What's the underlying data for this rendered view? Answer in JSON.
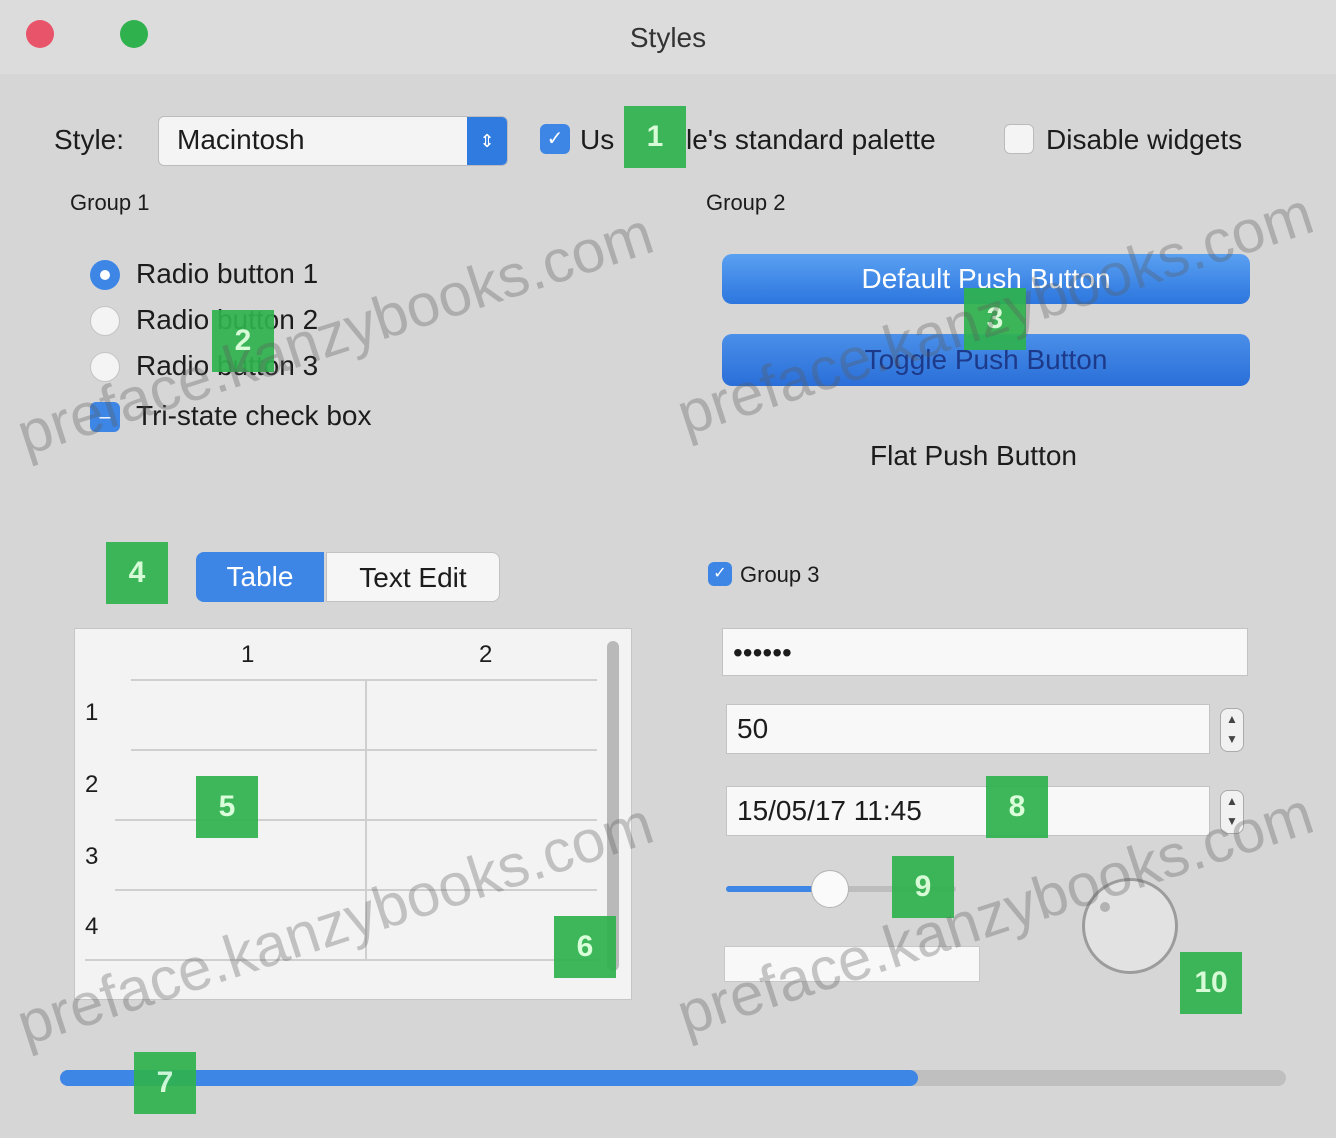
{
  "window": {
    "title": "Styles"
  },
  "toolbar": {
    "style_label": "Style:",
    "style_value": "Macintosh",
    "palette_label_start": "Us",
    "palette_label_end": "le's standard palette",
    "palette_checked": true,
    "disable_label": "Disable widgets",
    "disable_checked": false
  },
  "group1": {
    "title": "Group 1",
    "radios": [
      {
        "label": "Radio button 1",
        "checked": true
      },
      {
        "label": "Radio button 2",
        "checked": false
      },
      {
        "label": "Radio button 3",
        "checked": false
      }
    ],
    "tristate": {
      "label": "Tri-state check box"
    }
  },
  "group2": {
    "title": "Group 2",
    "default_button": "Default Push Button",
    "toggle_button": "Toggle Push Button",
    "flat_button": "Flat Push Button"
  },
  "tabs": {
    "items": [
      "Table",
      "Text Edit"
    ],
    "active": "Table"
  },
  "table": {
    "columns": [
      "1",
      "2"
    ],
    "rows": [
      "1",
      "2",
      "3",
      "4"
    ]
  },
  "group3": {
    "title": "Group 3",
    "checked": true,
    "password": "••••••",
    "spin_value": "50",
    "datetime": "15/05/17 11:45",
    "slider_value": 0.45
  },
  "progress": {
    "value": 0.7
  },
  "markers": [
    "1",
    "2",
    "3",
    "4",
    "5",
    "6",
    "7",
    "8",
    "9",
    "10"
  ],
  "watermark": "preface.kanzybooks.com",
  "icons": {
    "combo_arrow": "chevron-updown-icon",
    "checkmark": "check-icon",
    "stepper": "stepper-icon"
  },
  "colors": {
    "accent": "#3d86e6",
    "window_bg": "#d6d6d6",
    "marker": "#2fb24e",
    "close": "#e8556a",
    "zoom": "#2fb24e"
  }
}
